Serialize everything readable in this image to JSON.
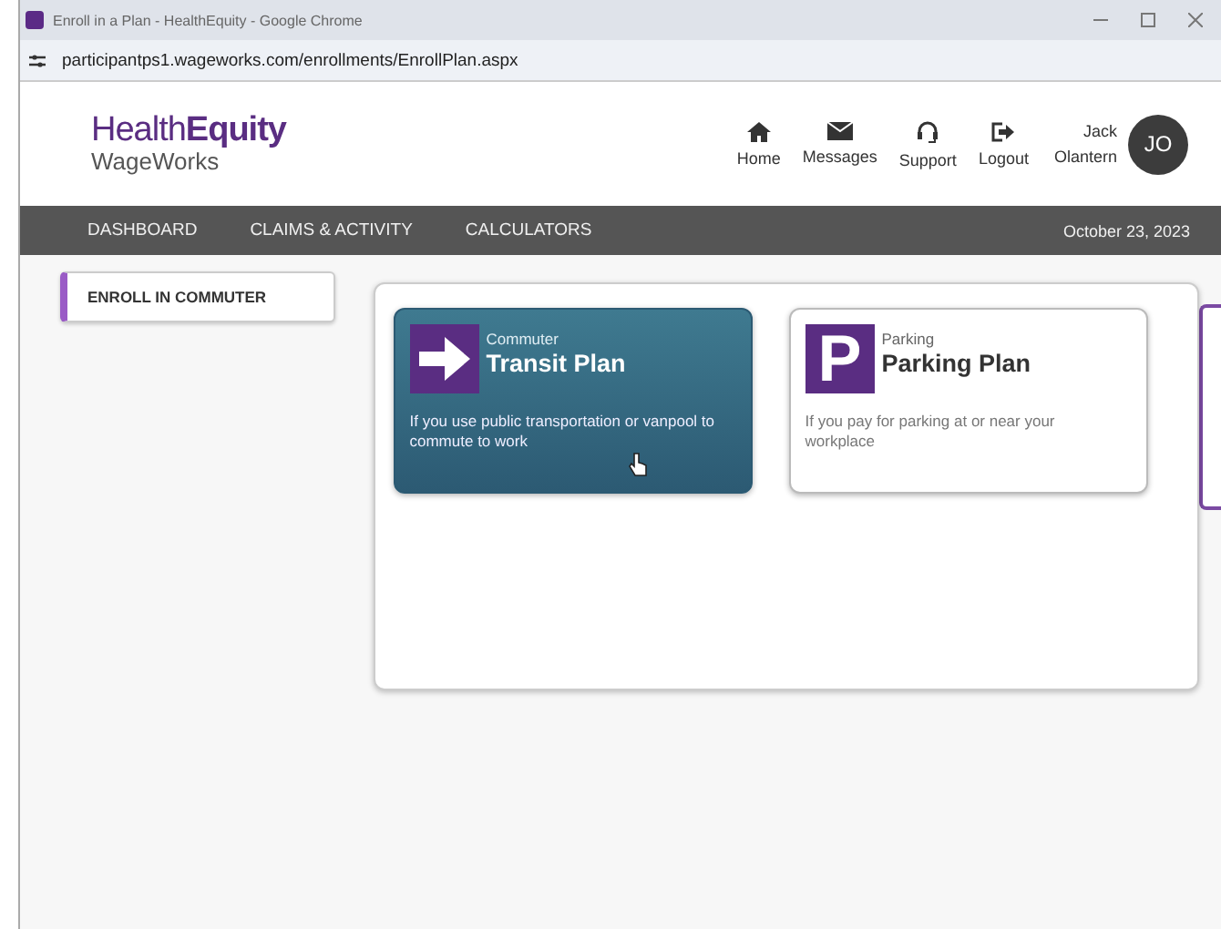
{
  "browser": {
    "tab_title": "Enroll in a Plan - HealthEquity - Google Chrome",
    "url": "participantps1.wageworks.com/enrollments/EnrollPlan.aspx"
  },
  "brand": {
    "name_light": "Health",
    "name_bold": "Equity",
    "sub": "WageWorks"
  },
  "header_links": [
    {
      "kind": "home",
      "label": "Home"
    },
    {
      "kind": "messages",
      "label": "Messages"
    },
    {
      "kind": "support",
      "label": "Support"
    },
    {
      "kind": "logout",
      "label": "Logout"
    }
  ],
  "user": {
    "first": "Jack",
    "last": "Olantern",
    "initials": "JO"
  },
  "nav": {
    "items": [
      "DASHBOARD",
      "CLAIMS & ACTIVITY",
      "CALCULATORS"
    ],
    "date": "October 23, 2023"
  },
  "sidebar": {
    "items": [
      {
        "label": "ENROLL IN COMMUTER",
        "selected": true
      }
    ]
  },
  "plans": [
    {
      "kind": "transit",
      "category": "Commuter",
      "title": "Transit Plan",
      "description": "If you use public transportation or vanpool to commute to work",
      "selected": true
    },
    {
      "kind": "parking",
      "icon_letter": "P",
      "category": "Parking",
      "title": "Parking Plan",
      "description": "If you pay for parking at or near your workplace",
      "selected": false
    }
  ]
}
